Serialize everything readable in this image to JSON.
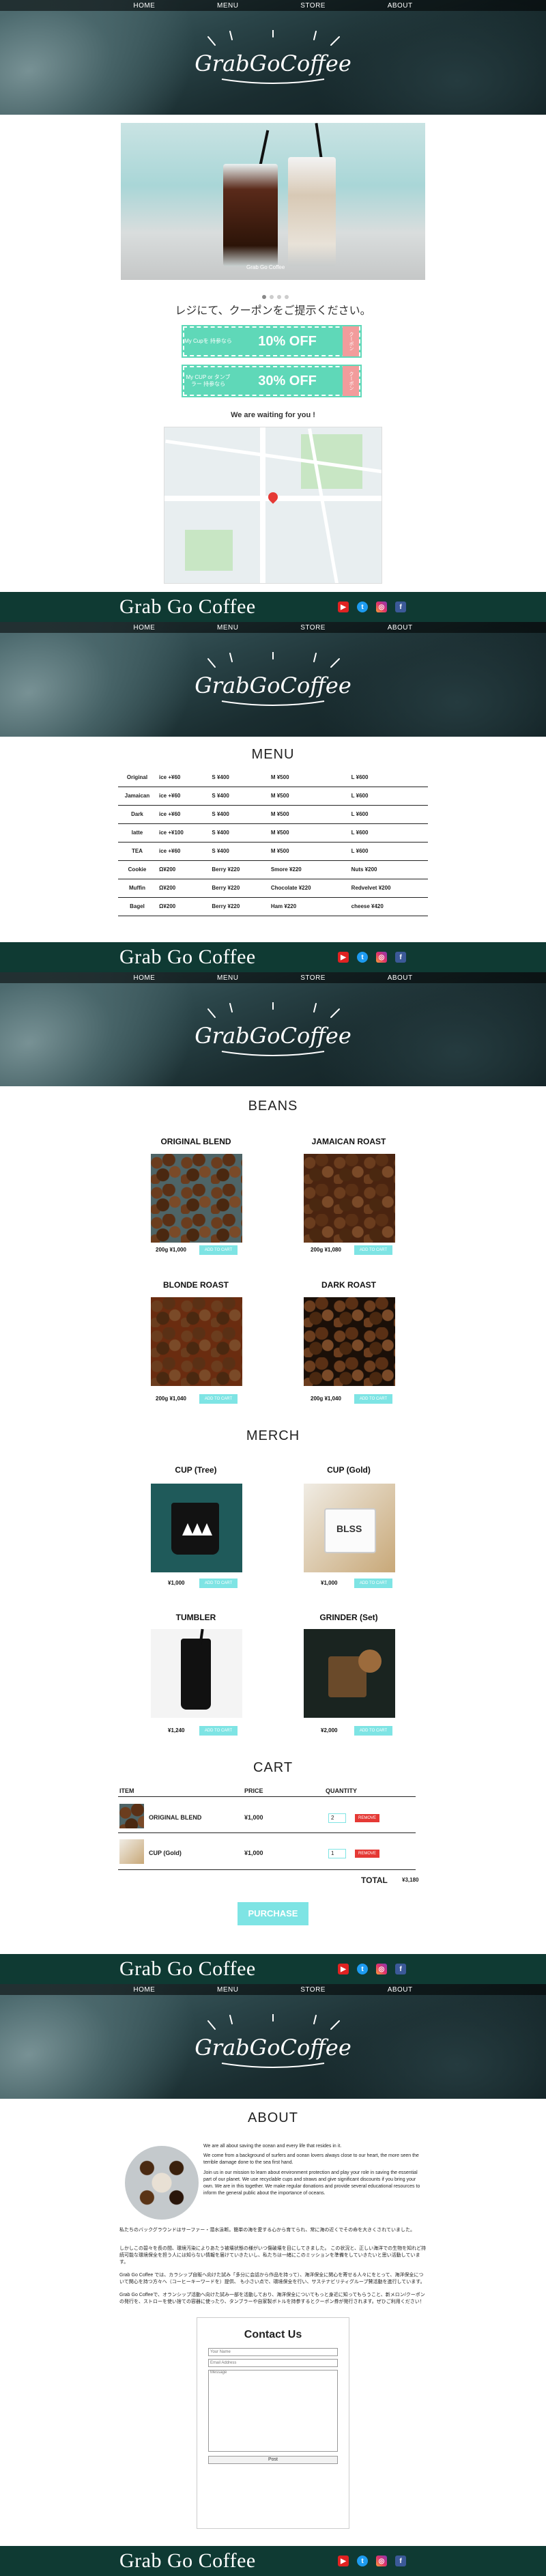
{
  "nav": {
    "home": "HOME",
    "menu": "MENU",
    "store": "STORE",
    "about": "ABOUT"
  },
  "logo_text": "GrabGoCoffee",
  "brand": "Grab Go Coffee",
  "socials": [
    {
      "name": "youtube-icon",
      "glyph": "▶"
    },
    {
      "name": "twitter-icon",
      "glyph": "t"
    },
    {
      "name": "instagram-icon",
      "glyph": "◎"
    },
    {
      "name": "facebook-icon",
      "glyph": "f"
    }
  ],
  "coupon_page": {
    "photo_caption": "Grab Go Coffee",
    "title": "レジにて、クーポンをご提示ください。",
    "coupons": [
      {
        "left": "My Cupを\n持参なら",
        "main": "10% OFF",
        "tab": "クーポン"
      },
      {
        "left": "My CUP or タンブラー\n持参なら",
        "main": "30% OFF",
        "tab": "クーポン"
      }
    ],
    "waiting": "We are waiting for you !"
  },
  "menu_page": {
    "title": "MENU",
    "rows": [
      [
        "Original",
        "ice +¥60",
        "S ¥400",
        "M ¥500",
        "L ¥600"
      ],
      [
        "Jamaican",
        "ice +¥60",
        "S ¥400",
        "M ¥500",
        "L ¥600"
      ],
      [
        "Dark",
        "ice +¥60",
        "S ¥400",
        "M ¥500",
        "L ¥600"
      ],
      [
        "latte",
        "ice +¥100",
        "S ¥400",
        "M ¥500",
        "L ¥600"
      ],
      [
        "TEA",
        "ice +¥60",
        "S ¥400",
        "M ¥500",
        "L ¥600"
      ],
      [
        "Cookie",
        "Ω¥200",
        "Berry ¥220",
        "Smore ¥220",
        "Nuts ¥200"
      ],
      [
        "Muffin",
        "Ω¥200",
        "Berry ¥220",
        "Chocolate ¥220",
        "Redvelvet ¥200"
      ],
      [
        "Bagel",
        "Ω¥200",
        "Berry ¥220",
        "Ham ¥220",
        "cheese ¥420"
      ]
    ]
  },
  "beans_page": {
    "title": "BEANS",
    "items": [
      {
        "name": "ORIGINAL BLEND",
        "price": "200g ¥1,000",
        "btn": "ADD TO CART"
      },
      {
        "name": "JAMAICAN ROAST",
        "price": "200g ¥1,080",
        "btn": "ADD TO CART"
      },
      {
        "name": "BLONDE ROAST",
        "price": "200g ¥1,040",
        "btn": "ADD TO CART"
      },
      {
        "name": "DARK ROAST",
        "price": "200g ¥1,040",
        "btn": "ADD TO CART"
      }
    ]
  },
  "merch": {
    "title": "MERCH",
    "items": [
      {
        "name": "CUP (Tree)",
        "price": "¥1,000",
        "btn": "ADD TO CART"
      },
      {
        "name": "CUP (Gold)",
        "price": "¥1,000",
        "btn": "ADD TO CART"
      },
      {
        "name": "TUMBLER",
        "price": "¥1,240",
        "btn": "ADD TO CART"
      },
      {
        "name": "GRINDER (Set)",
        "price": "¥2,000",
        "btn": "ADD TO CART"
      }
    ]
  },
  "cart": {
    "title": "CART",
    "headers": {
      "item": "ITEM",
      "price": "PRICE",
      "quantity": "QUANTITY"
    },
    "rows": [
      {
        "name": "ORIGINAL BLEND",
        "price": "¥1,000",
        "qty": "2",
        "remove": "REMOVE"
      },
      {
        "name": "CUP (Gold)",
        "price": "¥1,000",
        "qty": "1",
        "remove": "REMOVE"
      }
    ],
    "total_label": "TOTAL",
    "total_value": "¥3,180",
    "purchase": "PURCHASE"
  },
  "about": {
    "title": "ABOUT",
    "p1": "We are all about saving the ocean and every life that resides in it.",
    "p2": "We come from a background of surfers and ocean lovers always close to our heart, the more seen the terrible damage done to the sea first hand.",
    "p3": "Join us in our mission to learn about environment protection and play your role in saving the essential part of our planet. We use recyclable cups and straws and give significant discounts if you bring your own. We are in this together. We make regular donations and provide several educational resources to inform the general public about the importance of oceans.",
    "p4": "私たちのバックグラウンドはサーファー・潜水泳断。簡単の海を愛する心から育てられ、常に海の近くでその命を大きくされていました。",
    "p5": "しかしこの碧々を長の間、環境汚染によりあたう被壊状態の様がいつ傷破壊を目にしてきました。\nこの状況と、正しい海洋での生物を知れど持続可能な環境保全を担う人には知らない情報を届けていきたいし、私たちは一緒にこのミッションを準備をしていきたいと思い活動しています。",
    "p6": "Grab Go Coffee では、カラシップ自販へ向けた試み「多分に会話から作品を持って）、海洋保全に関心を寄せる人々にをとって、海洋保全について関心を持つ方々へ（コーヒーキーワードを）提供、\nも小さい点で、環境保全を行い、サステナビリティグループ賛活動を進行しています。",
    "p7": "Grab Go Coffeeで、オランシップ活動へ向けた試み一部を活動しており、海洋保全についてもっと身近に知ってもらうこと、新メロン/クーポンの発行を、ストローを使い捨ての容器に使ったり、タンブラーや自家製ボトルを持参するとクーポン券が発行されます。ぜひご利用ください！",
    "contact": {
      "title": "Contact Us",
      "name_ph": "Your Name",
      "email_ph": "Email Address",
      "msg_ph": "Message",
      "post": "Post"
    }
  }
}
